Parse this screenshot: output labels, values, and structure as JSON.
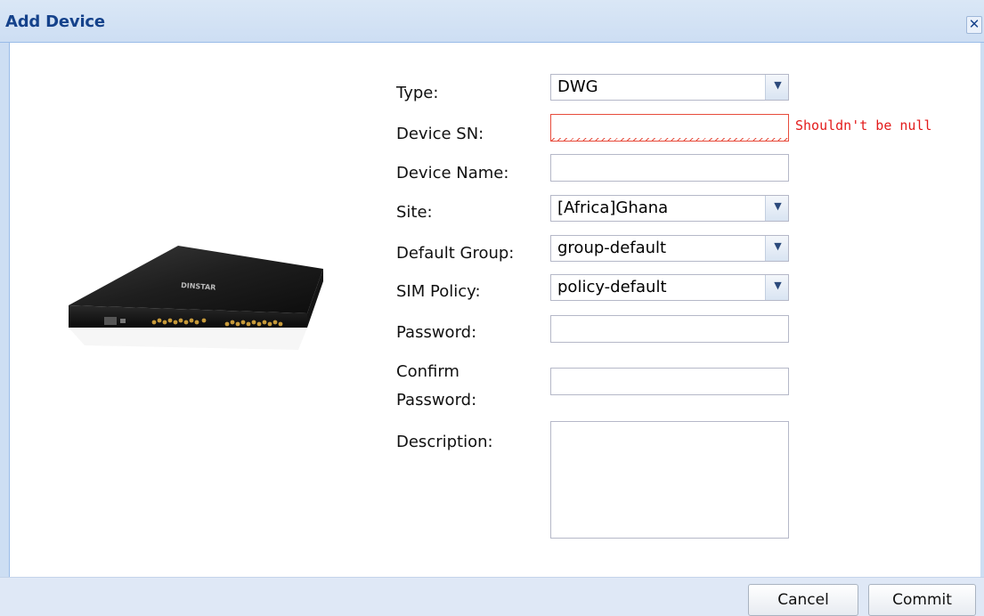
{
  "dialog": {
    "title": "Add Device",
    "close_icon": "close-icon",
    "close_glyph": "✕"
  },
  "device_image": {
    "brand_text": "DINSTAR"
  },
  "form": {
    "type": {
      "label": "Type:",
      "value": "DWG"
    },
    "device_sn": {
      "label": "Device SN:",
      "value": "",
      "error": "Shouldn't be null"
    },
    "device_name": {
      "label": "Device Name:",
      "value": ""
    },
    "site": {
      "label": "Site:",
      "value": "[Africa]Ghana"
    },
    "default_group": {
      "label": "Default Group:",
      "value": "group-default"
    },
    "sim_policy": {
      "label": "SIM Policy:",
      "value": "policy-default"
    },
    "password": {
      "label": "Password:",
      "value": ""
    },
    "confirm_password": {
      "label_line1": "Confirm",
      "label_line2": "Password:",
      "value": ""
    },
    "description": {
      "label": "Description:",
      "value": ""
    }
  },
  "footer": {
    "cancel_label": "Cancel",
    "commit_label": "Commit"
  },
  "colors": {
    "title_text": "#15428b",
    "error": "#e31b1b",
    "titlebar_bg": "#cddef3",
    "footer_bg": "#dfe8f6"
  },
  "icons": {
    "dropdown": "chevron-down-icon",
    "dropdown_glyph": "▼"
  }
}
